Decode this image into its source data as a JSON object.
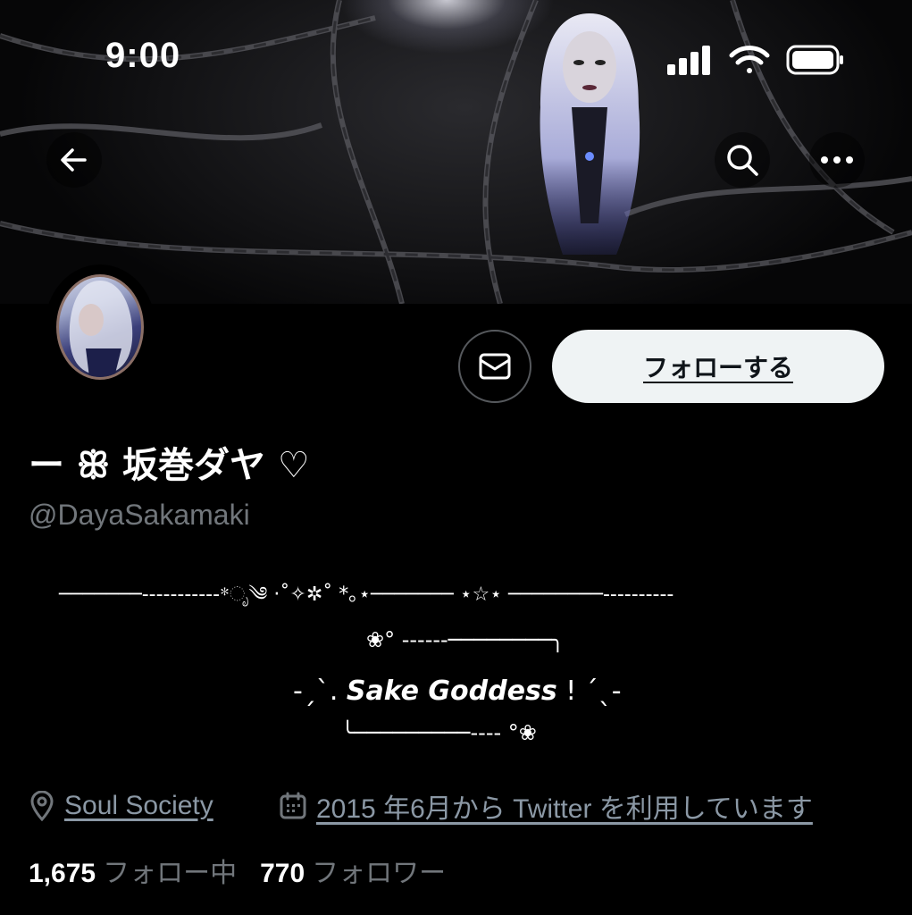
{
  "status_bar": {
    "time": "9:00",
    "icons": [
      "cellular-signal-icon",
      "wifi-icon",
      "battery-icon"
    ]
  },
  "nav": {
    "back_icon": "back-arrow-icon",
    "search_icon": "search-icon",
    "more_icon": "more-horizontal-icon"
  },
  "profile": {
    "display_name": "ー ꕥ 坂巻ダヤ ♡",
    "handle": "@DayaSakamaki",
    "message_icon": "envelope-icon",
    "follow_label": "フォローする"
  },
  "bio": {
    "line1": "───────-----------*ೃ༄ ·˚✧✲˚ *｡⋆─────── ⋆☆⋆ ────────----------",
    "line2": "❀° ------────────╮",
    "line3_left": "-ˏˋ. ",
    "line3_main": "Sake Goddess",
    "line3_right": " ! ˊˎ-",
    "line4": "╰─────────---- °❀"
  },
  "meta": {
    "location_icon": "location-pin-icon",
    "location": "Soul Society",
    "calendar_icon": "calendar-icon",
    "joined": "2015 年6月から Twitter を利用しています"
  },
  "stats": {
    "following_count": "1,675",
    "following_label": "フォロー中",
    "followers_count": "770",
    "followers_label": "フォロワー"
  },
  "colors": {
    "background": "#000000",
    "secondary_text": "#71767b",
    "follow_button_bg": "#eff3f4",
    "follow_button_text": "#0f1419"
  }
}
